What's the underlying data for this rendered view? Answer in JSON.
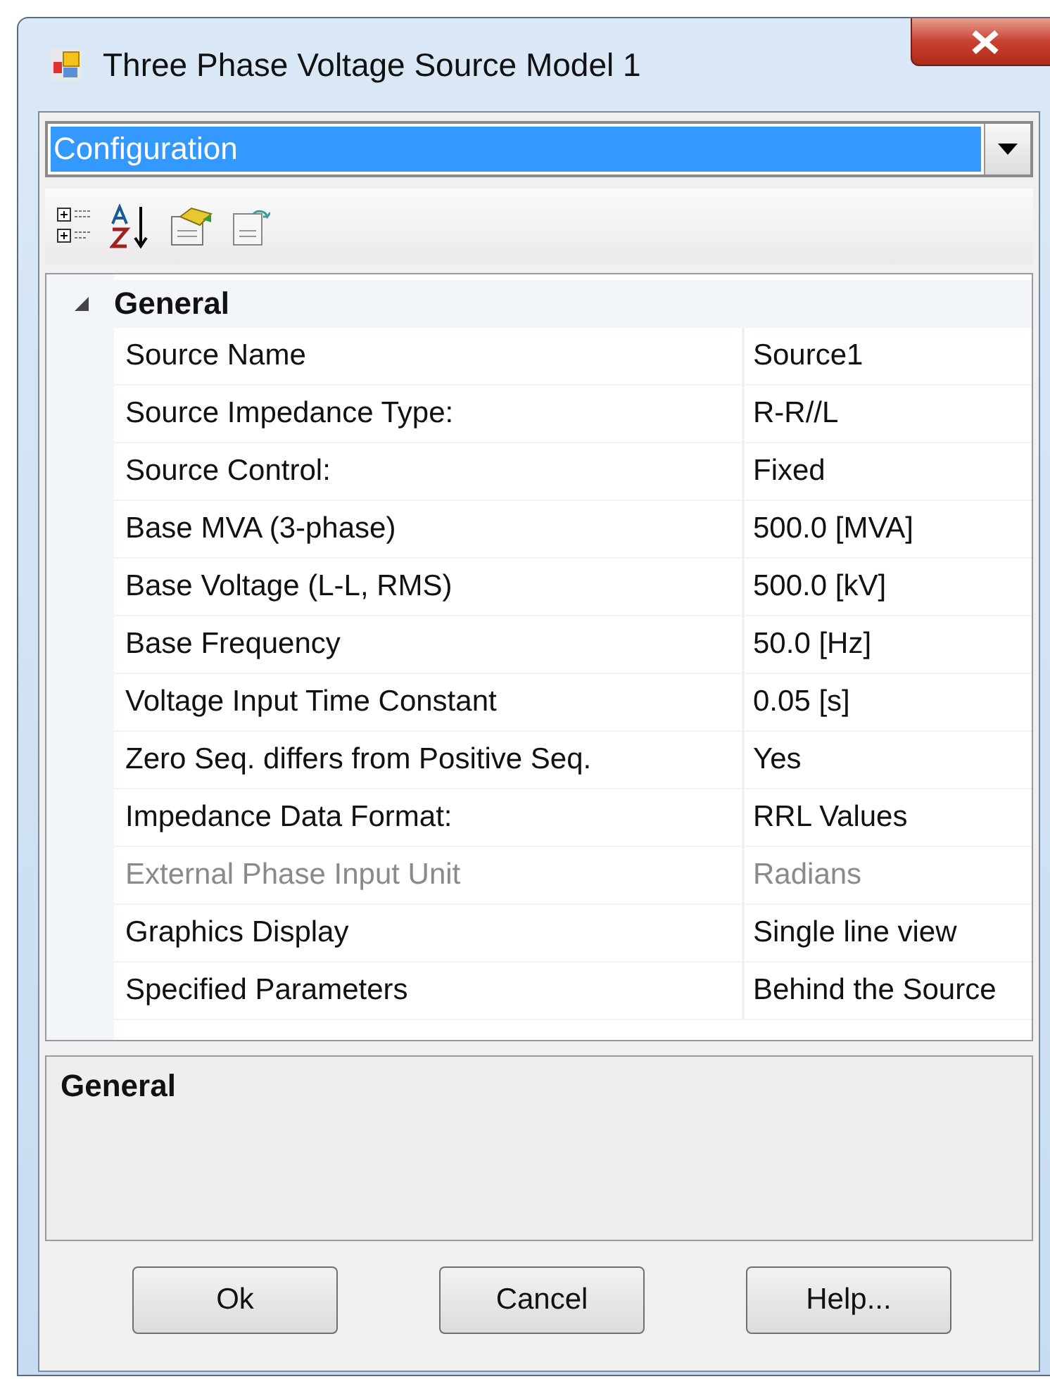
{
  "window": {
    "title": "Three Phase Voltage Source Model 1"
  },
  "category_select": {
    "value": "Configuration"
  },
  "grid": {
    "groups": [
      {
        "label": "General",
        "expanded": true,
        "properties": [
          {
            "name": "Source Name",
            "value": "Source1",
            "disabled": false
          },
          {
            "name": "Source Impedance Type:",
            "value": "R-R//L",
            "disabled": false
          },
          {
            "name": "Source Control:",
            "value": "Fixed",
            "disabled": false
          },
          {
            "name": "Base MVA (3-phase)",
            "value": "500.0 [MVA]",
            "disabled": false
          },
          {
            "name": "Base Voltage (L-L, RMS)",
            "value": "500.0 [kV]",
            "disabled": false
          },
          {
            "name": "Base Frequency",
            "value": "50.0 [Hz]",
            "disabled": false
          },
          {
            "name": "Voltage Input Time Constant",
            "value": "0.05 [s]",
            "disabled": false
          },
          {
            "name": "Zero Seq. differs from Positive Seq.",
            "value": "Yes",
            "disabled": false
          },
          {
            "name": "Impedance Data Format:",
            "value": "RRL Values",
            "disabled": false
          },
          {
            "name": "External Phase Input Unit",
            "value": "Radians",
            "disabled": true
          },
          {
            "name": "Graphics Display",
            "value": "Single line view",
            "disabled": false
          },
          {
            "name": "Specified Parameters",
            "value": "Behind the Source",
            "disabled": false
          }
        ]
      }
    ]
  },
  "description": {
    "title": "General"
  },
  "buttons": [
    "Ok",
    "Cancel",
    "Help..."
  ]
}
